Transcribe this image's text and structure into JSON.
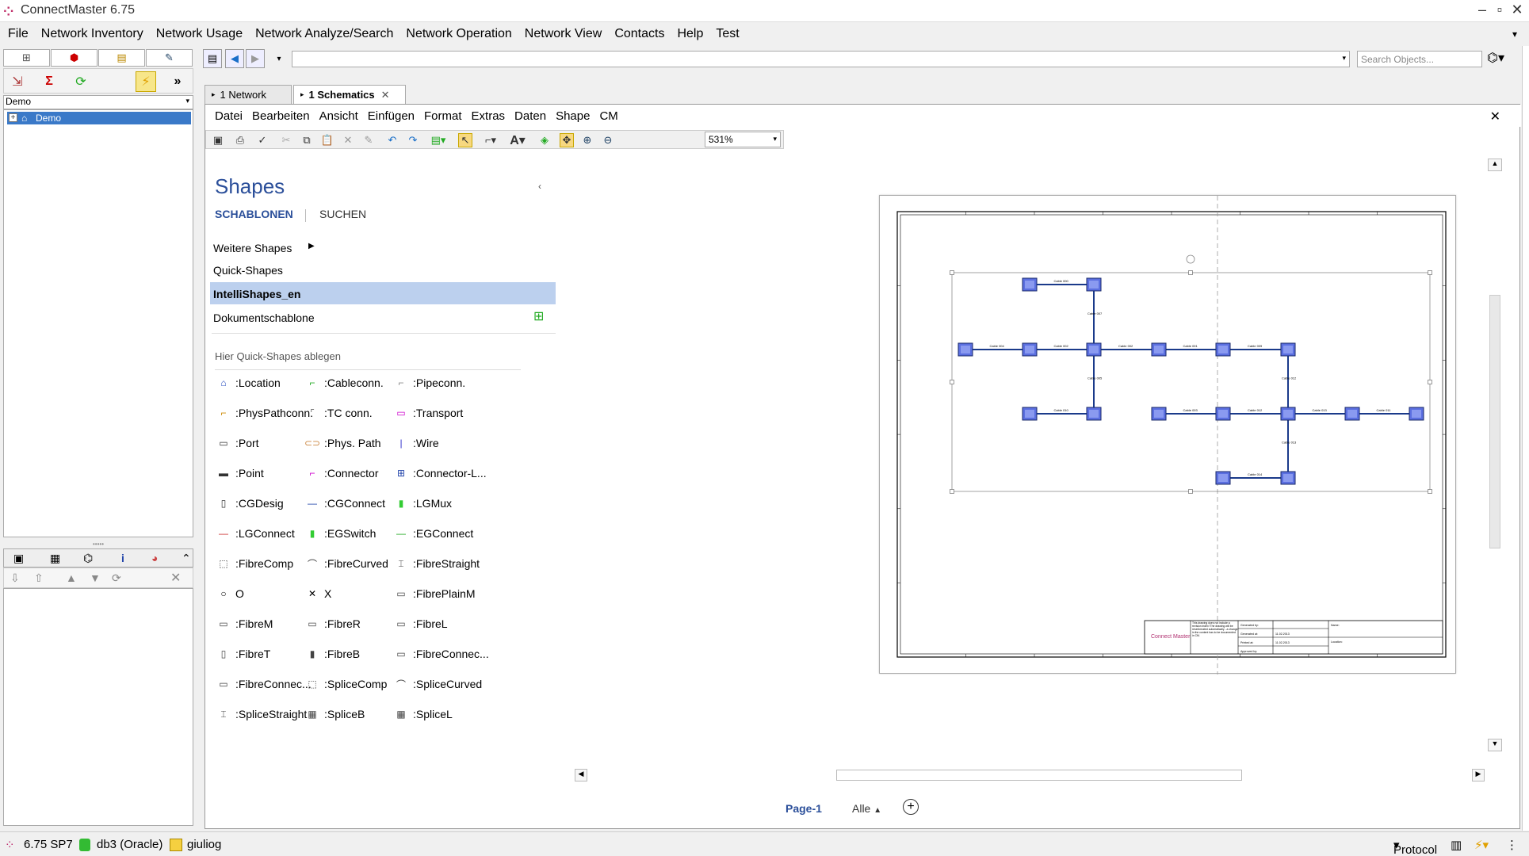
{
  "app": {
    "title": "ConnectMaster 6.75"
  },
  "menu": [
    "File",
    "Network Inventory",
    "Network Usage",
    "Network Analyze/Search",
    "Network Operation",
    "Network View",
    "Contacts",
    "Help",
    "Test"
  ],
  "left": {
    "tree_selector": "Demo",
    "tree_item": "Demo"
  },
  "nav": {
    "search_placeholder": "Search Objects..."
  },
  "doc_tabs": [
    {
      "label": "1 Network"
    },
    {
      "label": "1 Schematics"
    }
  ],
  "viewer_menu": [
    "Datei",
    "Bearbeiten",
    "Ansicht",
    "Einfügen",
    "Format",
    "Extras",
    "Daten",
    "Shape",
    "CM"
  ],
  "zoom": "531%",
  "shapes_panel": {
    "title": "Shapes",
    "tab_templates": "SCHABLONEN",
    "tab_search": "SUCHEN",
    "rows": [
      "Weitere Shapes",
      "Quick-Shapes",
      "IntelliShapes_en",
      "Dokumentschablone"
    ],
    "hint": "Hier Quick-Shapes ablegen",
    "items": [
      ":Location",
      ":Cableconn.",
      ":Pipeconn.",
      ":PhysPathconn.",
      ":TC conn.",
      ":Transport",
      ":Port",
      ":Phys. Path",
      ":Wire",
      ":Point",
      ":Connector",
      ":Connector-L...",
      ":CGDesig",
      ":CGConnect",
      ":LGMux",
      ":LGConnect",
      ":EGSwitch",
      ":EGConnect",
      ":FibreComp",
      ":FibreCurved",
      ":FibreStraight",
      "O",
      "X",
      ":FibrePlainM",
      ":FibreM",
      ":FibreR",
      ":FibreL",
      ":FibreT",
      ":FibreB",
      ":FibreConnec...",
      ":FibreConnec...",
      ":SpliceComp",
      ":SpliceCurved",
      ":SpliceStraight",
      ":SpliceB",
      ":SpliceL"
    ]
  },
  "drawing": {
    "cable_labels": [
      "Cable 000",
      "Cable 007",
      "Cable 004",
      "Cable 002",
      "Cable 002",
      "Cable 001",
      "Cable 009",
      "Cable 005",
      "Cable 010",
      "Cable 003",
      "Cable 012",
      "Cable 013",
      "Cable 011",
      "Cable 012",
      "Cable 013",
      "Cable 014"
    ],
    "titleblock": {
      "logo": "Connect Master",
      "note": "This drawing does not include a revision index! The drawing will be reset/created automatically - a change in the content has to be documented in CM.",
      "generated_by": "Generated by:",
      "generated_at": "Generated at:",
      "printed_at": "Printed at:",
      "approved_by": "Approved by:",
      "date1": "11.02.2013",
      "date2": "11.02.2013",
      "name": "Name:",
      "location": "Location:"
    }
  },
  "page_bar": {
    "page": "Page-1",
    "all": "Alle"
  },
  "status": {
    "version": "6.75 SP7",
    "db": "db3 (Oracle)",
    "user": "giuliog",
    "protocol": "Protocol"
  }
}
